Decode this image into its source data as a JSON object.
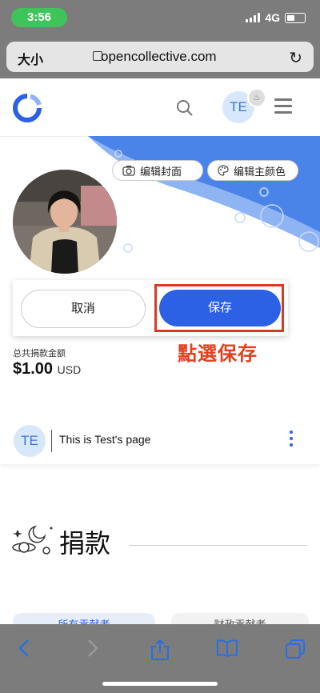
{
  "status_bar": {
    "time": "3:56",
    "network": "4G"
  },
  "browser": {
    "text_size": "大小",
    "url": "opencollective.com"
  },
  "header": {
    "avatar_initials": "TE"
  },
  "cover": {
    "edit_cover_label": "编辑封面",
    "edit_color_label": "编辑主颜色"
  },
  "actions": {
    "cancel_label": "取消",
    "save_label": "保存"
  },
  "annotation": "點選保存",
  "totals": {
    "label": "总共捐款金额",
    "amount": "$1.00",
    "currency": "USD"
  },
  "page": {
    "avatar_initials": "TE",
    "title": "This is Test's page"
  },
  "donate": {
    "title": "捐款"
  },
  "tabs": {
    "left": "所有贡献者",
    "right": "财政贡献者"
  },
  "colors": {
    "primary": "#2c61e5",
    "annotation": "#e2401f",
    "status_green": "#3ec45a"
  }
}
